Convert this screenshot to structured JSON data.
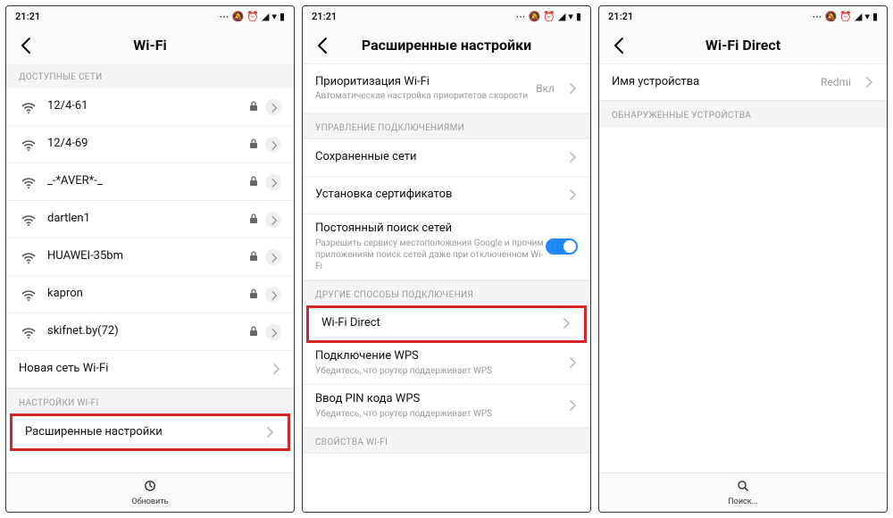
{
  "statusbar": {
    "time": "21:21"
  },
  "screen1": {
    "title": "Wi-Fi",
    "section_networks": "ДОСТУПНЫЕ СЕТИ",
    "networks": [
      {
        "ssid": "12/4-61"
      },
      {
        "ssid": "12/4-69"
      },
      {
        "ssid": "_-*AVER*-_"
      },
      {
        "ssid": "dartlen1"
      },
      {
        "ssid": "HUAWEI-35bm"
      },
      {
        "ssid": "kapron"
      },
      {
        "ssid": "skifnet.by(72)"
      }
    ],
    "new_network": "Новая сеть Wi-Fi",
    "section_settings": "НАСТРОЙКИ WI-FI",
    "advanced": "Расширенные настройки",
    "refresh": "Обновить"
  },
  "screen2": {
    "title": "Расширенные настройки",
    "priority_title": "Приоритизация Wi-Fi",
    "priority_sub": "Автоматическая настройка приоритетов скорости",
    "priority_value": "Вкл",
    "section_conn": "УПРАВЛЕНИЕ ПОДКЛЮЧЕНИЯМИ",
    "saved_networks": "Сохраненные сети",
    "install_certs": "Установка сертификатов",
    "scan_title": "Постоянный поиск сетей",
    "scan_sub": "Разрешить сервису местоположения Google и прочим приложениям поиск сетей даже при отключенном Wi-Fi",
    "section_other": "ДРУГИЕ СПОСОБЫ ПОДКЛЮЧЕНИЯ",
    "wifi_direct": "Wi-Fi Direct",
    "wps_title": "Подключение WPS",
    "wps_sub": "Убедитесь, что роутер поддерживает WPS",
    "wps_pin_title": "Ввод PIN кода WPS",
    "wps_pin_sub": "Убедитесь, что роутер поддерживает WPS",
    "section_props": "СВОЙСТВА WI-FI"
  },
  "screen3": {
    "title": "Wi-Fi Direct",
    "device_name_label": "Имя устройства",
    "device_name_value": "Redmi",
    "section_discovered": "ОБНАРУЖЕННЫЕ УСТРОЙСТВА",
    "search": "Поиск..."
  }
}
